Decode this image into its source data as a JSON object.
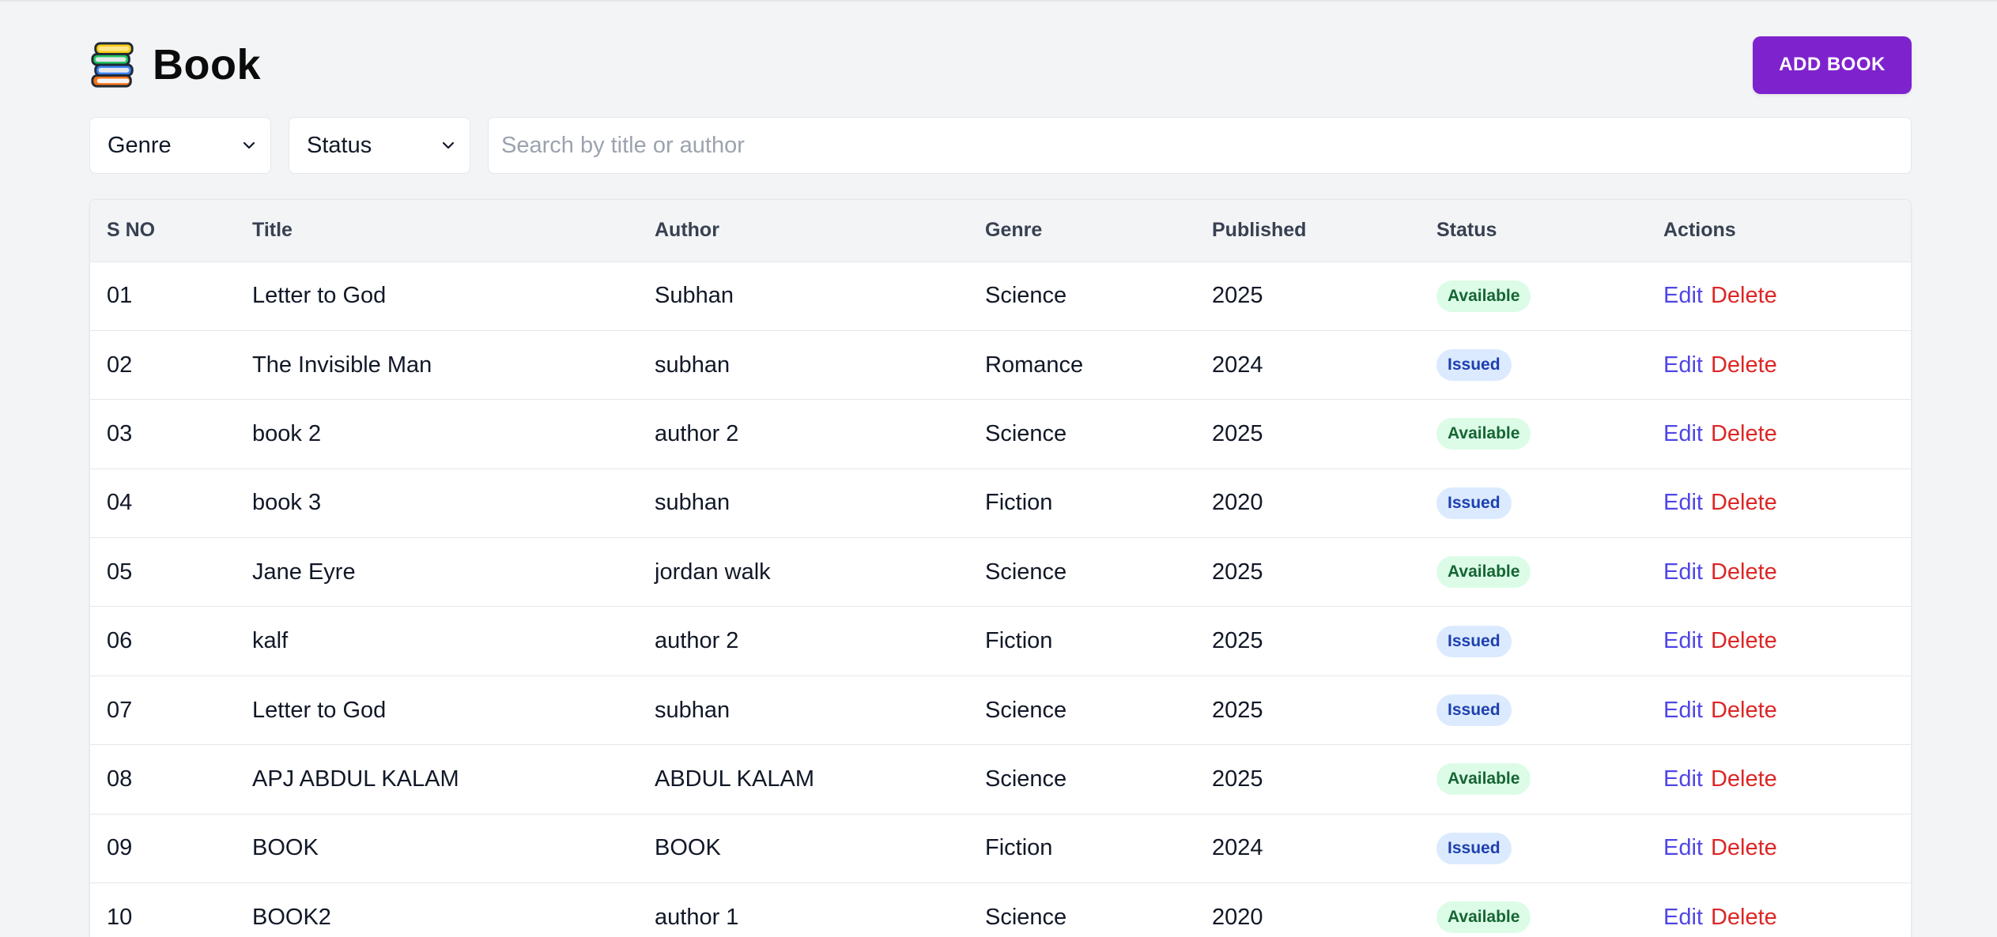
{
  "header": {
    "title": "Book",
    "icon": "books-icon",
    "add_button_label": "ADD BOOK"
  },
  "filters": {
    "genre_select": "Genre",
    "status_select": "Status",
    "search_placeholder": "Search by title or author",
    "search_value": ""
  },
  "colors": {
    "accent": "#7e22ce",
    "edit": "#4f46e5",
    "delete": "#dc2626",
    "available_bg": "#dcfce7",
    "available_text": "#166534",
    "issued_bg": "#dbeafe",
    "issued_text": "#1e40af"
  },
  "table": {
    "columns": [
      "S NO",
      "Title",
      "Author",
      "Genre",
      "Published",
      "Status",
      "Actions"
    ],
    "action_labels": {
      "edit": "Edit",
      "delete": "Delete"
    },
    "rows": [
      {
        "sno": "01",
        "title": "Letter to God",
        "author": "Subhan",
        "genre": "Science",
        "published": "2025",
        "status": "Available"
      },
      {
        "sno": "02",
        "title": "The Invisible Man",
        "author": "subhan",
        "genre": "Romance",
        "published": "2024",
        "status": "Issued"
      },
      {
        "sno": "03",
        "title": "book 2",
        "author": "author 2",
        "genre": "Science",
        "published": "2025",
        "status": "Available"
      },
      {
        "sno": "04",
        "title": "book 3",
        "author": "subhan",
        "genre": "Fiction",
        "published": "2020",
        "status": "Issued"
      },
      {
        "sno": "05",
        "title": "Jane Eyre",
        "author": "jordan walk",
        "genre": "Science",
        "published": "2025",
        "status": "Available"
      },
      {
        "sno": "06",
        "title": "kalf",
        "author": "author 2",
        "genre": "Fiction",
        "published": "2025",
        "status": "Issued"
      },
      {
        "sno": "07",
        "title": "Letter to God",
        "author": "subhan",
        "genre": "Science",
        "published": "2025",
        "status": "Issued"
      },
      {
        "sno": "08",
        "title": "APJ ABDUL KALAM",
        "author": "ABDUL KALAM",
        "genre": "Science",
        "published": "2025",
        "status": "Available"
      },
      {
        "sno": "09",
        "title": "BOOK",
        "author": "BOOK",
        "genre": "Fiction",
        "published": "2024",
        "status": "Issued"
      },
      {
        "sno": "10",
        "title": "BOOK2",
        "author": "author 1",
        "genre": "Science",
        "published": "2020",
        "status": "Available"
      }
    ]
  }
}
